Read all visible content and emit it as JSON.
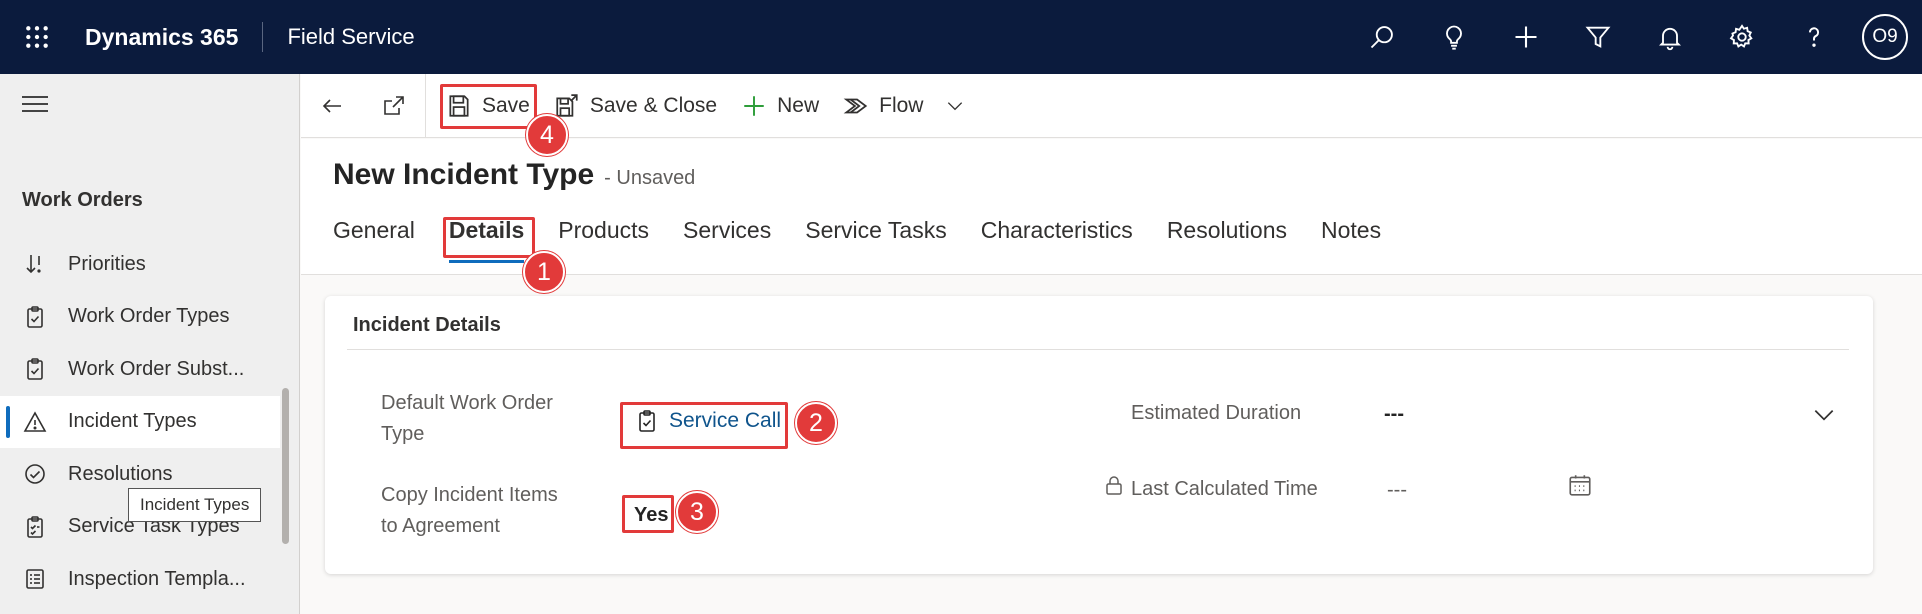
{
  "topbar": {
    "brand": "Dynamics 365",
    "app_name": "Field Service",
    "avatar_initials": "O9",
    "icons": [
      "search-icon",
      "lightbulb-icon",
      "plus-icon",
      "filter-icon",
      "bell-icon",
      "gear-icon",
      "help-icon"
    ]
  },
  "sidebar": {
    "group_title": "Work Orders",
    "items": [
      {
        "label": "Priorities",
        "icon": "priority-sort-icon"
      },
      {
        "label": "Work Order Types",
        "icon": "clipboard-icon"
      },
      {
        "label": "Work Order Subst...",
        "icon": "clipboard-icon"
      },
      {
        "label": "Incident Types",
        "icon": "warning-icon"
      },
      {
        "label": "Resolutions",
        "icon": "check-circle-icon"
      },
      {
        "label": "Service Task Types",
        "icon": "task-clipboard-icon"
      },
      {
        "label": "Inspection Templa...",
        "icon": "checklist-icon"
      }
    ],
    "tooltip": "Incident Types"
  },
  "commandbar": {
    "save": "Save",
    "save_close": "Save & Close",
    "new": "New",
    "flow": "Flow"
  },
  "header": {
    "title": "New Incident Type",
    "status": "- Unsaved",
    "tabs": [
      "General",
      "Details",
      "Products",
      "Services",
      "Service Tasks",
      "Characteristics",
      "Resolutions",
      "Notes"
    ],
    "active_tab": "Details"
  },
  "section": {
    "title": "Incident Details",
    "fields": {
      "default_work_order_type_label_1": "Default Work Order",
      "default_work_order_type_label_2": "Type",
      "default_work_order_type_value": "Service Call",
      "copy_items_label_1": "Copy Incident Items",
      "copy_items_label_2": "to Agreement",
      "copy_items_value": "Yes",
      "estimated_duration_label": "Estimated Duration",
      "estimated_duration_value": "---",
      "last_calculated_label": "Last Calculated Time",
      "last_calculated_value": "---"
    }
  },
  "annotations": {
    "badge_1": "1",
    "badge_2": "2",
    "badge_3": "3",
    "badge_4": "4",
    "highlight_color": "#e23a3a"
  },
  "colors": {
    "topbar": "#0b1b3d",
    "accent": "#0f6cbd",
    "link": "#0f548c"
  }
}
